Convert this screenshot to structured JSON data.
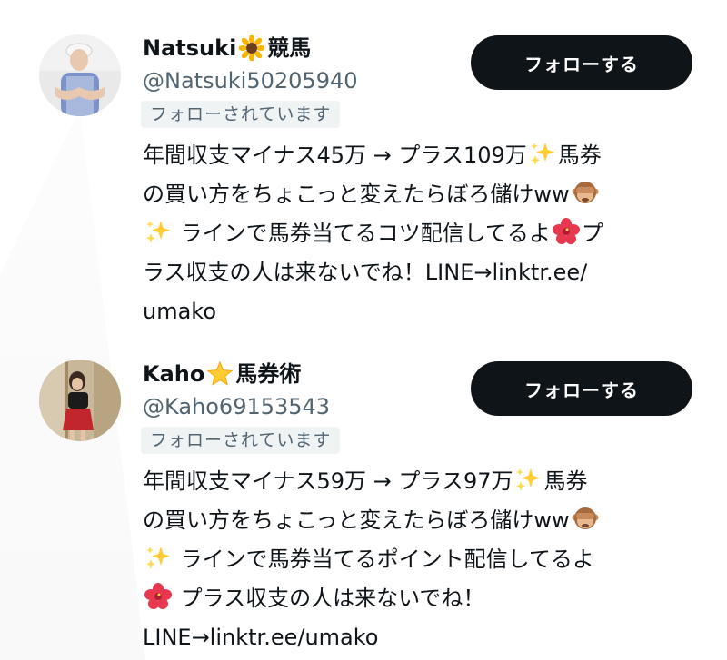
{
  "users": [
    {
      "name": "Natsuki",
      "name_suffix": "競馬",
      "name_icon": "sunflower-icon",
      "handle": "@Natsuki50205940",
      "follows_you": "フォローされています",
      "follow_label": "フォローする",
      "bio_lines": [
        {
          "parts": [
            {
              "text": "年間収支マイナス45万 → プラス109万"
            },
            {
              "icon": "sparkles-icon"
            },
            {
              "text": "馬券"
            }
          ]
        },
        {
          "parts": [
            {
              "text": "の買い方をちょこっと変えたらぼろ儲けww"
            },
            {
              "icon": "see-no-evil-monkey-icon"
            }
          ]
        },
        {
          "parts": [
            {
              "icon": "sparkles-icon"
            },
            {
              "text": " ラインで馬券当てるコツ配信してるよ"
            },
            {
              "icon": "hibiscus-icon"
            },
            {
              "text": "プ"
            }
          ]
        },
        {
          "parts": [
            {
              "text": "ラス収支の人は来ないでね！LINE→linktr.ee/"
            }
          ]
        },
        {
          "parts": [
            {
              "text": "umako"
            }
          ]
        }
      ]
    },
    {
      "name": "Kaho",
      "name_suffix": "馬券術",
      "name_icon": "star-icon",
      "handle": "@Kaho69153543",
      "follows_you": "フォローされています",
      "follow_label": "フォローする",
      "bio_lines": [
        {
          "parts": [
            {
              "text": "年間収支マイナス59万 → プラス97万"
            },
            {
              "icon": "sparkles-icon"
            },
            {
              "text": "馬券"
            }
          ]
        },
        {
          "parts": [
            {
              "text": "の買い方をちょこっと変えたらぼろ儲けww"
            },
            {
              "icon": "see-no-evil-monkey-icon"
            }
          ]
        },
        {
          "parts": [
            {
              "icon": "sparkles-icon"
            },
            {
              "text": " ラインで馬券当てるポイント配信してるよ"
            }
          ]
        },
        {
          "parts": [
            {
              "icon": "hibiscus-icon"
            },
            {
              "text": " プラス収支の人は来ないでね！"
            }
          ]
        },
        {
          "parts": [
            {
              "text": "LINE→linktr.ee/umako"
            }
          ]
        }
      ]
    }
  ],
  "colors": {
    "text_primary": "#0f1419",
    "text_secondary": "#536471",
    "badge_bg": "#eff3f4",
    "button_bg": "#0f1419",
    "button_text": "#ffffff"
  }
}
